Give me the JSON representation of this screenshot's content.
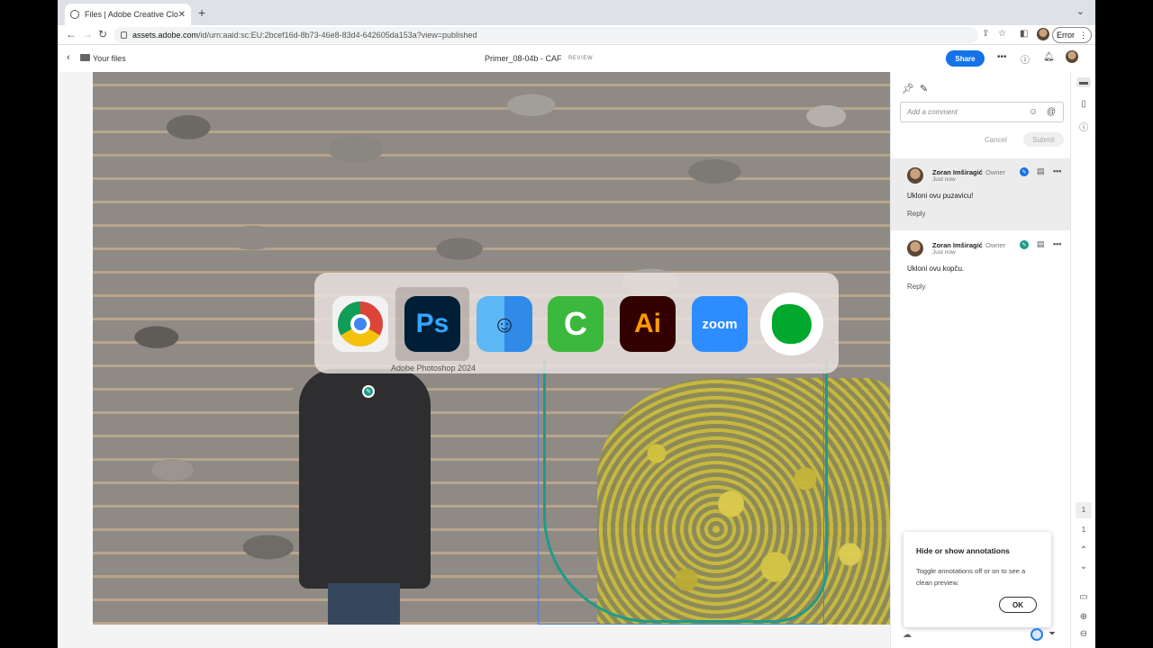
{
  "browser": {
    "tab_title": "Files | Adobe Creative Cloud",
    "tab_close": "✕",
    "new_tab": "+",
    "url_host": "assets.adobe.com",
    "url_path": "/id/urn:aaid:sc:EU:2bcef16d-8b73-46e8-83d4-642605da153a?view=published",
    "error_label": "Error"
  },
  "header": {
    "breadcrumb": "Your files",
    "doc_title": "Primer_08-04b - CAF",
    "doc_badge": "REVIEW",
    "share_label": "Share"
  },
  "app_switcher": {
    "apps": [
      {
        "name": "Google Chrome",
        "glyph": ""
      },
      {
        "name": "Adobe Photoshop 2024",
        "glyph": "Ps"
      },
      {
        "name": "Finder",
        "glyph": "☺"
      },
      {
        "name": "Camtasia",
        "glyph": "C"
      },
      {
        "name": "Adobe Illustrator",
        "glyph": "Ai"
      },
      {
        "name": "Zoom",
        "glyph": "zoom"
      },
      {
        "name": "Evernote",
        "glyph": ""
      }
    ],
    "selected_label": "Adobe Photoshop 2024"
  },
  "comments_panel": {
    "input_placeholder": "Add a comment",
    "cancel_label": "Cancel",
    "submit_label": "Submit",
    "comments": [
      {
        "author": "Zoran Imširagić",
        "role": "Owner",
        "time": "Just now",
        "text": "Ukloni ovu puzavicu!",
        "reply_label": "Reply"
      },
      {
        "author": "Zoran Imširagić",
        "role": "Owner",
        "time": "Just now",
        "text": "Ukloni ovu kopču.",
        "reply_label": "Reply"
      }
    ]
  },
  "tooltip": {
    "title": "Hide or show annotations",
    "body": "Toggle annotations off or on to see a clean preview.",
    "ok_label": "OK"
  },
  "rail": {
    "page_box": "1",
    "page_number": "1"
  },
  "colors": {
    "accent": "#1473e6",
    "annotation_teal": "#1e9b8a"
  }
}
